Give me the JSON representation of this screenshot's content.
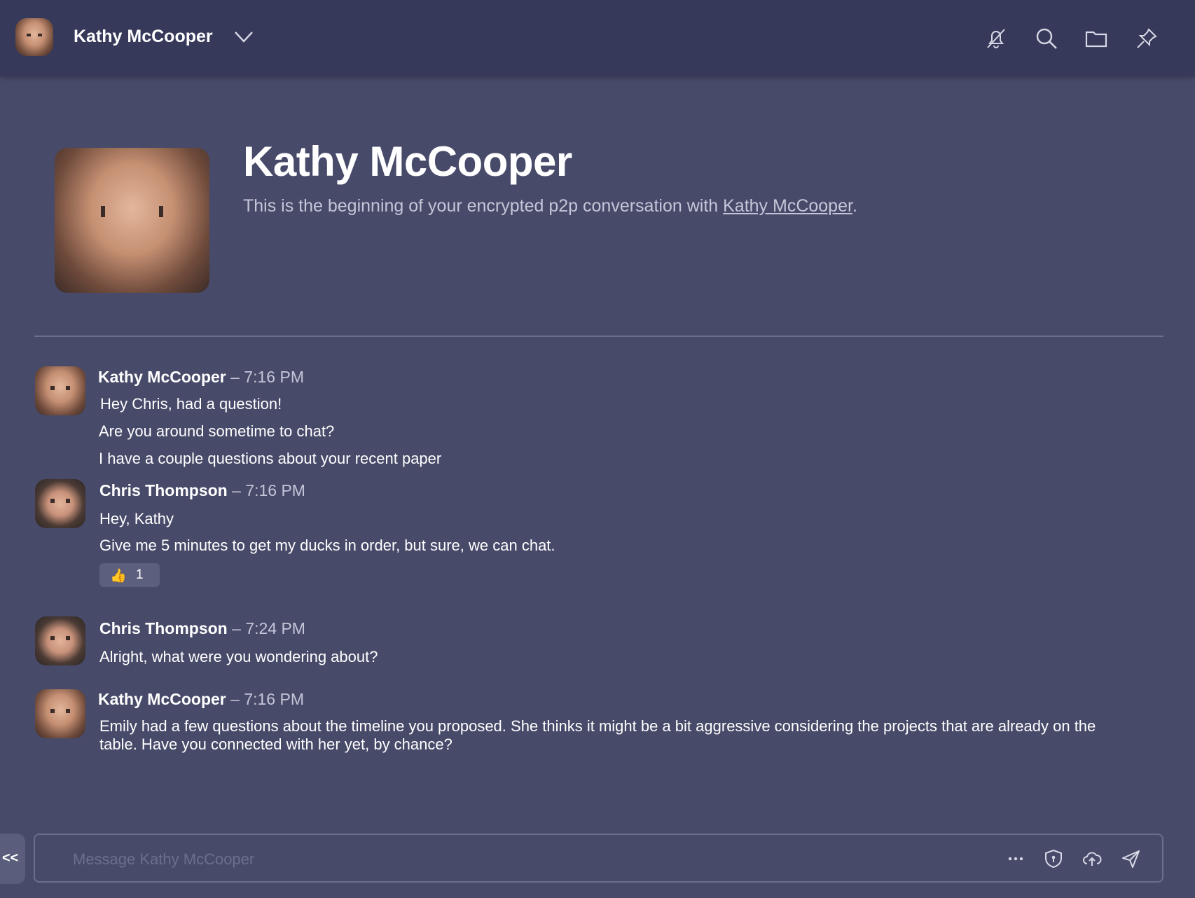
{
  "header": {
    "contact_name": "Kathy McCooper",
    "icons": [
      "bell-off-icon",
      "search-icon",
      "folder-icon",
      "pin-icon",
      "chevron-down-icon"
    ]
  },
  "intro": {
    "title": "Kathy McCooper",
    "description_prefix": "This is the beginning of your encrypted p2p conversation with ",
    "description_link": "Kathy McCooper",
    "description_suffix": "."
  },
  "messages": [
    {
      "author": "Kathy McCooper",
      "separator": " – ",
      "time": "7:16 PM",
      "lines": [
        "Hey Chris, had a question!",
        "Are you around sometime to chat?",
        "I have a couple questions about your recent paper"
      ]
    },
    {
      "author": "Chris Thompson",
      "separator": " – ",
      "time": "7:16 PM",
      "lines": [
        "Hey, Kathy",
        "Give me 5 minutes to get my ducks in order, but sure, we can chat."
      ],
      "reaction": {
        "emoji": "👍",
        "count": "1"
      }
    },
    {
      "author": "Chris Thompson",
      "separator": " – ",
      "time": "7:24 PM",
      "lines": [
        "Alright, what were you wondering about?"
      ]
    },
    {
      "author": "Kathy McCooper",
      "separator": " – ",
      "time": "7:16 PM",
      "lines": [
        "Emily had a few questions about the timeline you proposed. She thinks it might be a bit aggressive considering the projects that are already on the",
        "table. Have you connected with her yet, by chance?"
      ]
    }
  ],
  "composer": {
    "placeholder": "Message Kathy McCooper",
    "value": "",
    "collapse_label": "<<",
    "icons": [
      "more-icon",
      "shield-icon",
      "upload-cloud-icon",
      "send-icon"
    ]
  },
  "colors": {
    "background": "#474a69",
    "topbar": "#36395a",
    "muted_text": "#c4c6d8",
    "divider": "#6b6e8c"
  }
}
